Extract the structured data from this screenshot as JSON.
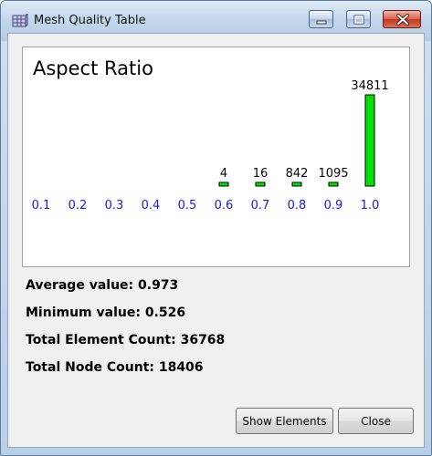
{
  "window": {
    "title": "Mesh Quality Table",
    "icon": "mesh-table-icon",
    "controls": [
      "minimize-icon",
      "maximize-icon",
      "close-icon"
    ]
  },
  "chart_data": {
    "type": "bar",
    "title": "Aspect Ratio",
    "categories": [
      "0.1",
      "0.2",
      "0.3",
      "0.4",
      "0.5",
      "0.6",
      "0.7",
      "0.8",
      "0.9",
      "1.0"
    ],
    "values": [
      0,
      0,
      0,
      0,
      0,
      4,
      16,
      842,
      1095,
      34811
    ],
    "data_labels": [
      "",
      "",
      "",
      "",
      "",
      "4",
      "16",
      "842",
      "1095",
      "34811"
    ],
    "bar_color": "#00e000",
    "category_color": "#1a1adc",
    "grid": false,
    "legend": "none"
  },
  "stats": {
    "average": "Average value: 0.973",
    "minimum": "Minimum value: 0.526",
    "elements": "Total Element Count: 36768",
    "nodes": "Total Node Count: 18406"
  },
  "buttons": {
    "show_elements": "Show Elements",
    "close": "Close"
  }
}
